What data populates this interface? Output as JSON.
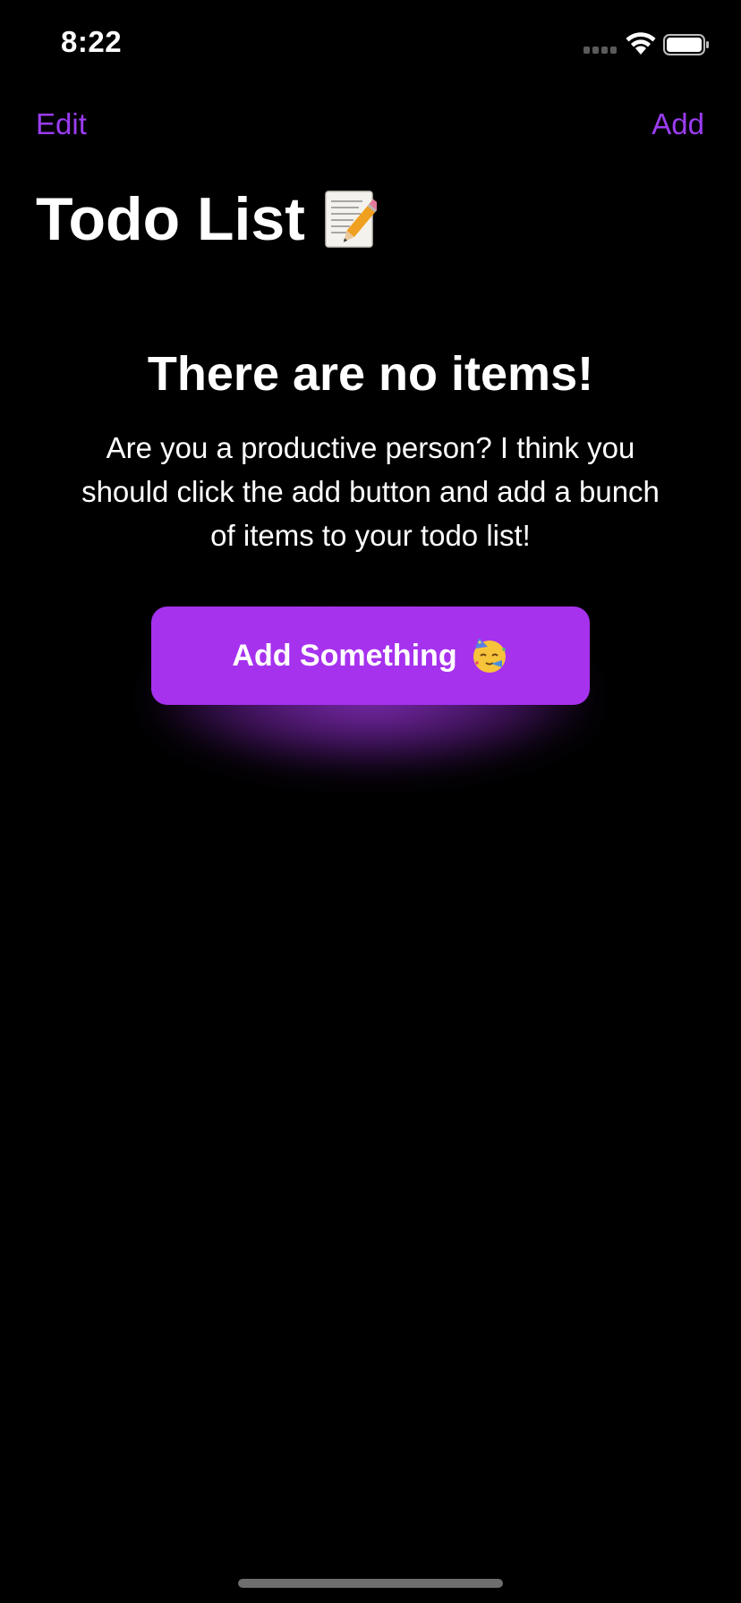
{
  "status_bar": {
    "time": "8:22",
    "icons": [
      "signal-icon",
      "wifi-icon",
      "battery-icon"
    ]
  },
  "nav": {
    "edit_label": "Edit",
    "add_label": "Add"
  },
  "header": {
    "title": "Todo List",
    "title_icon": "memo-icon"
  },
  "empty_state": {
    "heading": "There are no items!",
    "message": "Are you a productive person? I think you should click the add button and add a bunch of items to your todo list!",
    "button_label": "Add Something",
    "button_icon": "partying-face-icon"
  },
  "colors": {
    "background": "#000000",
    "accent": "#9b3cf2",
    "button": "#a632ee",
    "text": "#ffffff"
  }
}
